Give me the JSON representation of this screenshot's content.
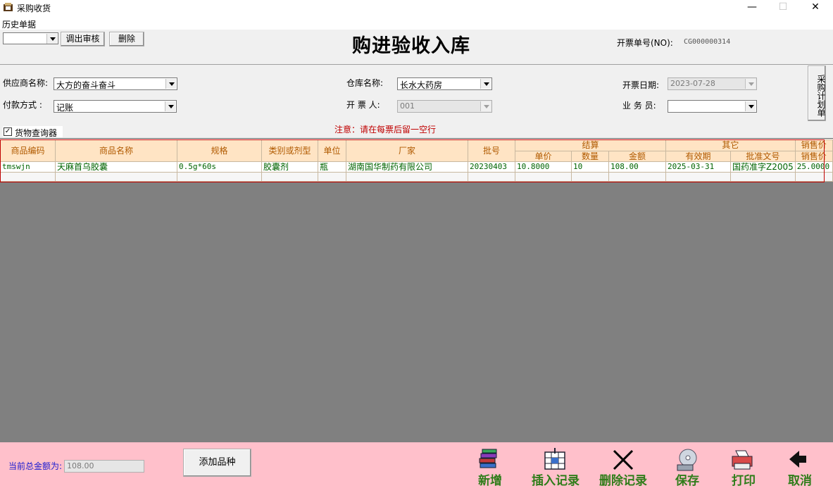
{
  "window": {
    "title": "采购收货",
    "min": "—",
    "max": "☐",
    "close": "✕"
  },
  "menu": {
    "history": "历史单据"
  },
  "top": {
    "history_select": "",
    "load_review_btn": "调出审核",
    "delete_btn": "删除",
    "heading": "购进验收入库",
    "invoice_no_label": "开票单号(NO):",
    "invoice_no": "CG000000314"
  },
  "form": {
    "supplier_label": "供应商名称:",
    "supplier_value": "大方的奋斗奋斗",
    "payment_label": "付款方式 :",
    "payment_value": "记账",
    "warehouse_label": "仓库名称:",
    "warehouse_value": "长水大药房",
    "issuer_label": "开 票 人:",
    "issuer_value": "001",
    "date_label": "开票日期:",
    "date_value": "2023-07-28",
    "salesman_label": "业 务 员:",
    "salesman_value": "",
    "plan_button": "采购计划单",
    "goods_query_label": "货物查询器",
    "goods_query_checked": true,
    "notice": "注意：请在每票后留一空行"
  },
  "grid": {
    "headers": {
      "code": "商品编码",
      "name": "商品名称",
      "spec": "规格",
      "category": "类别或剂型",
      "unit": "单位",
      "maker": "厂家",
      "batch": "批号",
      "settle": "结算",
      "price": "单价",
      "qty": "数量",
      "amount": "金额",
      "other": "其它",
      "expiry": "有效期",
      "approval": "批准文号",
      "sale_price_top": "销售价",
      "sale_price": "销售价"
    },
    "rows": [
      {
        "code": "tmswjn",
        "name": "天麻首乌胶囊",
        "spec": "0.5g*60s",
        "category": "胶囊剂",
        "unit": "瓶",
        "maker": "湖南国华制药有限公司",
        "batch": "20230403",
        "price": "10.8000",
        "qty": "10",
        "amount": "108.00",
        "expiry": "2025-03-31",
        "approval": "国药准字Z2005",
        "sale_price": "25.0000"
      }
    ]
  },
  "bottom": {
    "total_label": "当前总金额为:",
    "total_value": "108.00",
    "add_item_btn": "添加品种",
    "toolbar": {
      "new": "新增",
      "insert": "插入记录",
      "delete": "删除记录",
      "save": "保存",
      "print": "打印",
      "cancel": "取消"
    }
  },
  "colors": {
    "accent_red": "#c00000",
    "toolbar_green": "#2f7d1a",
    "bottom_bg": "#ffc0cb",
    "header_bg": "#ffe4c4"
  }
}
